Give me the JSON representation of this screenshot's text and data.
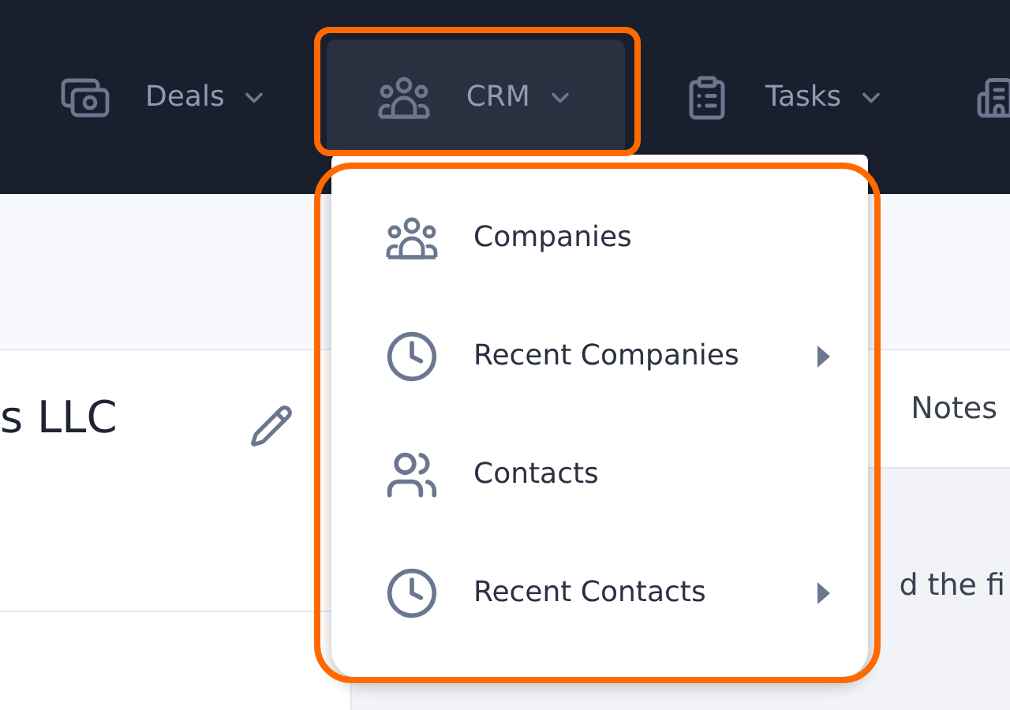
{
  "nav": {
    "items": [
      {
        "label": "Deals",
        "selected": false
      },
      {
        "label": "CRM",
        "selected": true
      },
      {
        "label": "Tasks",
        "selected": false
      }
    ]
  },
  "record": {
    "title": "s LLC"
  },
  "side_panel": {
    "tab": "Notes",
    "text": "d the fi"
  },
  "menu": {
    "items": [
      {
        "label": "Companies",
        "kind": "link"
      },
      {
        "label": "Recent Companies",
        "kind": "submenu"
      },
      {
        "label": "Contacts",
        "kind": "link"
      },
      {
        "label": "Recent Contacts",
        "kind": "submenu"
      }
    ]
  }
}
